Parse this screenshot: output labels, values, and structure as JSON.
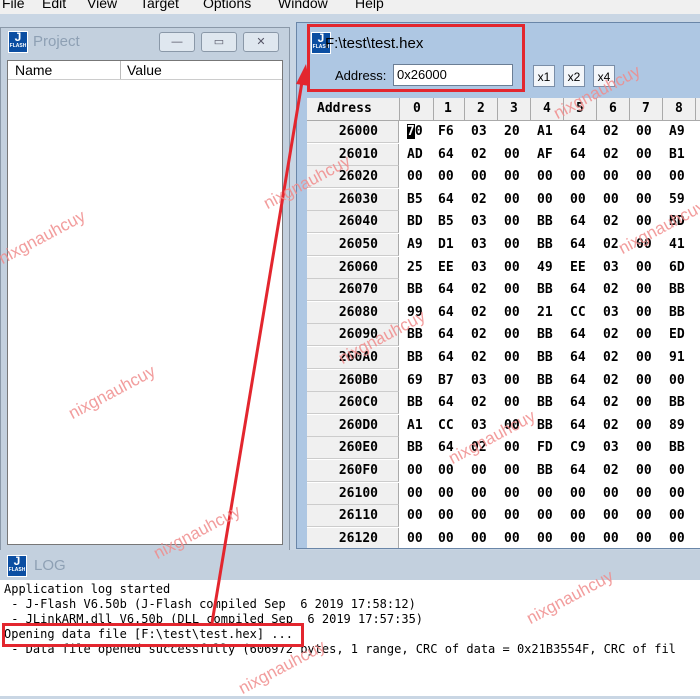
{
  "menu": [
    "File",
    "Edit",
    "View",
    "Target",
    "Options",
    "Window",
    "Help"
  ],
  "app_icon": {
    "letter": "J",
    "sub": "FLASH"
  },
  "project": {
    "title": "Project",
    "columns": [
      "Name",
      "Value"
    ],
    "buttons": {
      "minimize": "—",
      "restore": "▭",
      "close": "✕"
    }
  },
  "hexwin": {
    "title": "F:\\test\\test.hex",
    "address_label": "Address:",
    "address_value": "0x26000",
    "zoom": [
      "x1",
      "x2",
      "x4"
    ],
    "columns": [
      "Address",
      "0",
      "1",
      "2",
      "3",
      "4",
      "5",
      "6",
      "7",
      "8"
    ],
    "rows": [
      {
        "addr": "26000",
        "bytes": [
          "70",
          "F6",
          "03",
          "20",
          "A1",
          "64",
          "02",
          "00",
          "A9"
        ]
      },
      {
        "addr": "26010",
        "bytes": [
          "AD",
          "64",
          "02",
          "00",
          "AF",
          "64",
          "02",
          "00",
          "B1"
        ]
      },
      {
        "addr": "26020",
        "bytes": [
          "00",
          "00",
          "00",
          "00",
          "00",
          "00",
          "00",
          "00",
          "00"
        ]
      },
      {
        "addr": "26030",
        "bytes": [
          "B5",
          "64",
          "02",
          "00",
          "00",
          "00",
          "00",
          "00",
          "59"
        ]
      },
      {
        "addr": "26040",
        "bytes": [
          "BD",
          "B5",
          "03",
          "00",
          "BB",
          "64",
          "02",
          "00",
          "BD"
        ]
      },
      {
        "addr": "26050",
        "bytes": [
          "A9",
          "D1",
          "03",
          "00",
          "BB",
          "64",
          "02",
          "00",
          "41"
        ]
      },
      {
        "addr": "26060",
        "bytes": [
          "25",
          "EE",
          "03",
          "00",
          "49",
          "EE",
          "03",
          "00",
          "6D"
        ]
      },
      {
        "addr": "26070",
        "bytes": [
          "BB",
          "64",
          "02",
          "00",
          "BB",
          "64",
          "02",
          "00",
          "BB"
        ]
      },
      {
        "addr": "26080",
        "bytes": [
          "99",
          "64",
          "02",
          "00",
          "21",
          "CC",
          "03",
          "00",
          "BB"
        ]
      },
      {
        "addr": "26090",
        "bytes": [
          "BB",
          "64",
          "02",
          "00",
          "BB",
          "64",
          "02",
          "00",
          "ED"
        ]
      },
      {
        "addr": "260A0",
        "bytes": [
          "BB",
          "64",
          "02",
          "00",
          "BB",
          "64",
          "02",
          "00",
          "91"
        ]
      },
      {
        "addr": "260B0",
        "bytes": [
          "69",
          "B7",
          "03",
          "00",
          "BB",
          "64",
          "02",
          "00",
          "00"
        ]
      },
      {
        "addr": "260C0",
        "bytes": [
          "BB",
          "64",
          "02",
          "00",
          "BB",
          "64",
          "02",
          "00",
          "BB"
        ]
      },
      {
        "addr": "260D0",
        "bytes": [
          "A1",
          "CC",
          "03",
          "00",
          "BB",
          "64",
          "02",
          "00",
          "89"
        ]
      },
      {
        "addr": "260E0",
        "bytes": [
          "BB",
          "64",
          "02",
          "00",
          "FD",
          "C9",
          "03",
          "00",
          "BB"
        ]
      },
      {
        "addr": "260F0",
        "bytes": [
          "00",
          "00",
          "00",
          "00",
          "BB",
          "64",
          "02",
          "00",
          "00"
        ]
      },
      {
        "addr": "26100",
        "bytes": [
          "00",
          "00",
          "00",
          "00",
          "00",
          "00",
          "00",
          "00",
          "00"
        ]
      },
      {
        "addr": "26110",
        "bytes": [
          "00",
          "00",
          "00",
          "00",
          "00",
          "00",
          "00",
          "00",
          "00"
        ]
      },
      {
        "addr": "26120",
        "bytes": [
          "00",
          "00",
          "00",
          "00",
          "00",
          "00",
          "00",
          "00",
          "00"
        ]
      }
    ]
  },
  "log": {
    "title": "LOG",
    "lines": [
      "Application log started",
      " - J-Flash V6.50b (J-Flash compiled Sep  6 2019 17:58:12)",
      " - JLinkARM.dll V6.50b (DLL compiled Sep  6 2019 17:57:35)",
      "Opening data file [F:\\test\\test.hex] ...",
      " - Data file opened successfully (606972 bytes, 1 range, CRC of data = 0x21B3554F, CRC of fil"
    ]
  },
  "watermark": "nixgnauhcuy"
}
